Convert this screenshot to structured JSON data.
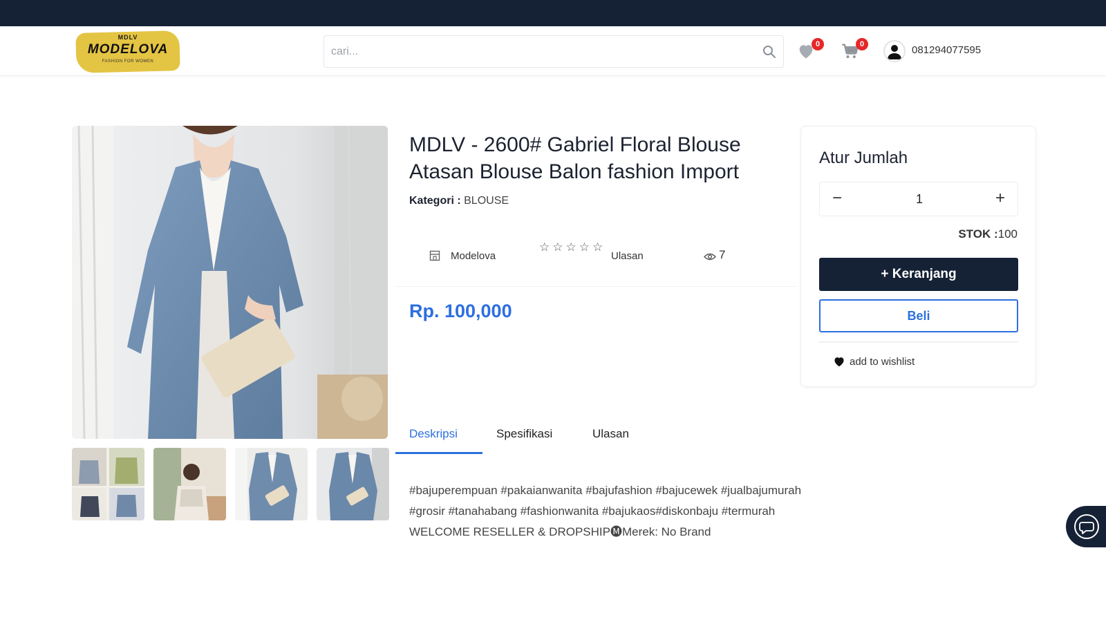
{
  "header": {
    "logo": {
      "small": "MDLV",
      "main": "MODELOVA",
      "tagline": "FASHION FOR WOMEN"
    },
    "search": {
      "placeholder": "cari..."
    },
    "wishlist_count": "0",
    "cart_count": "0",
    "user_phone": "081294077595",
    "icons": [
      "search-icon",
      "heart-icon",
      "cart-icon",
      "user-avatar-icon"
    ]
  },
  "product": {
    "title": "MDLV - 2600# Gabriel Floral Blouse Atasan Blouse Balon fashion Import",
    "category_label": "Kategori :",
    "category_value": "BLOUSE",
    "store_name": "Modelova",
    "stars": "☆☆☆☆☆",
    "reviews_label": "Ulasan",
    "views": "7",
    "price": "Rp. 100,000",
    "thumbnails": [
      "thumbnail-1",
      "thumbnail-2",
      "thumbnail-3",
      "thumbnail-4"
    ]
  },
  "tabs": {
    "items": [
      "Deskripsi",
      "Spesifikasi",
      "Ulasan"
    ],
    "active": "Deskripsi"
  },
  "description": "#bajuperempuan #pakaianwanita #bajufashion #bajucewek #jualbajumurah #grosir #tanahabang #fashionwanita #bajukaos#diskonbaju #termurah WELCOME RESELLER & DROPSHIP🅜Merek: No Brand",
  "panel": {
    "title": "Atur Jumlah",
    "minus": "−",
    "plus": "+",
    "quantity": "1",
    "stock_label": "STOK :",
    "stock_value": "100",
    "cart_button": "+ Keranjang",
    "buy_button": "Beli",
    "wishlist_link": "add to wishlist"
  },
  "colors": {
    "navy": "#152236",
    "accent_blue": "#2c6fe0",
    "badge_red": "#e62828",
    "logo_yellow": "#e4c443"
  }
}
